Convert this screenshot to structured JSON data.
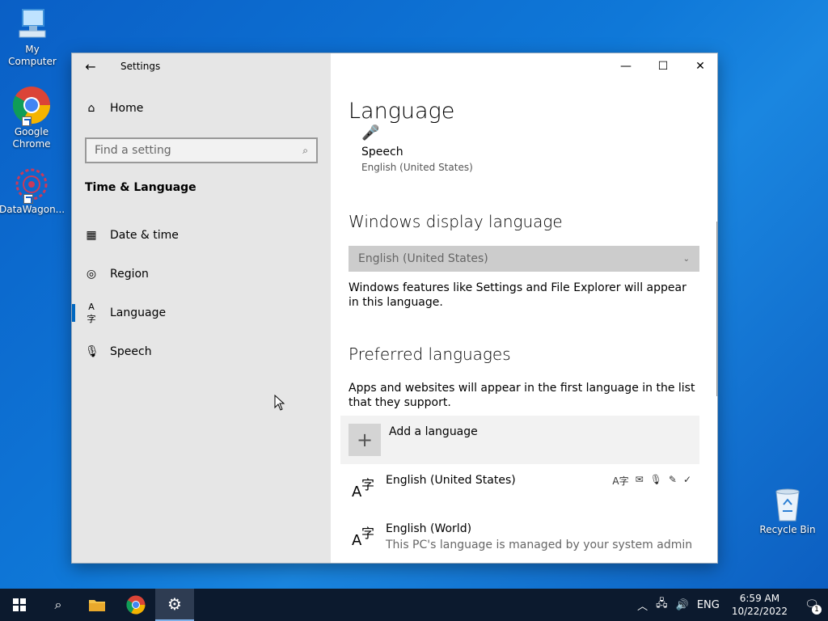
{
  "desktop": {
    "icons": [
      {
        "label": "My Computer"
      },
      {
        "label": "Google Chrome"
      },
      {
        "label": "DataWagon..."
      },
      {
        "label": "Recycle Bin"
      }
    ]
  },
  "window": {
    "app_title": "Settings",
    "sidebar": {
      "home_label": "Home",
      "search_placeholder": "Find a setting",
      "section_heading": "Time & Language",
      "items": [
        {
          "label": "Date & time",
          "icon": "calendar-clock-icon"
        },
        {
          "label": "Region",
          "icon": "globe-icon"
        },
        {
          "label": "Language",
          "icon": "language-icon",
          "active": true
        },
        {
          "label": "Speech",
          "icon": "microphone-icon"
        }
      ]
    },
    "content": {
      "page_title": "Language",
      "speech": {
        "title": "Speech",
        "subtitle": "English (United States)"
      },
      "display_language": {
        "heading": "Windows display language",
        "selected": "English (United States)",
        "description": "Windows features like Settings and File Explorer will appear in this language."
      },
      "preferred": {
        "heading": "Preferred languages",
        "description": "Apps and websites will appear in the first language in the list that they support.",
        "add_label": "Add a language",
        "languages": [
          {
            "name": "English (United States)",
            "sub": ""
          },
          {
            "name": "English (World)",
            "sub": "This PC's language is managed by your system admin"
          }
        ]
      }
    }
  },
  "taskbar": {
    "tray": {
      "lang": "ENG",
      "time": "6:59 AM",
      "date": "10/22/2022",
      "notifications": "1"
    }
  },
  "colors": {
    "accent": "#0067c0",
    "taskbar": "#0c1a2e",
    "sidebar": "#e6e6e6"
  }
}
